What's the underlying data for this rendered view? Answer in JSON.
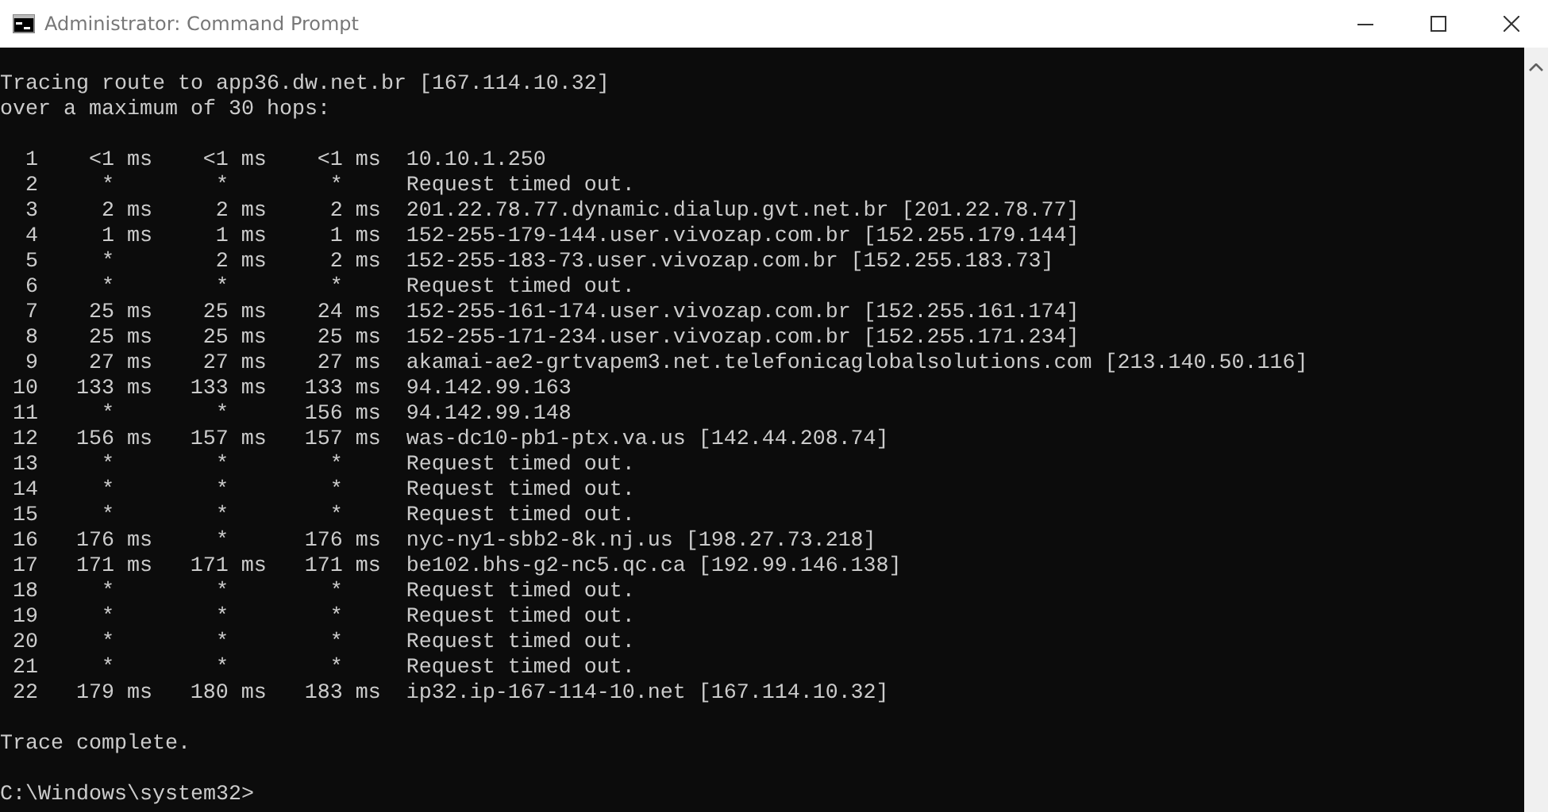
{
  "window": {
    "title": "Administrator: Command Prompt"
  },
  "header": [
    "Tracing route to app36.dw.net.br [167.114.10.32]",
    "over a maximum of 30 hops:"
  ],
  "hops": [
    {
      "hop": "1",
      "times": [
        {
          "text": "<1 ms",
          "timed_out": false
        },
        {
          "text": "<1 ms",
          "timed_out": false
        },
        {
          "text": "<1 ms",
          "timed_out": false
        }
      ],
      "host": "10.10.1.250"
    },
    {
      "hop": "2",
      "times": [
        {
          "text": "*",
          "timed_out": true
        },
        {
          "text": "*",
          "timed_out": true
        },
        {
          "text": "*",
          "timed_out": true
        }
      ],
      "host": "Request timed out."
    },
    {
      "hop": "3",
      "times": [
        {
          "text": "2 ms",
          "timed_out": false
        },
        {
          "text": "2 ms",
          "timed_out": false
        },
        {
          "text": "2 ms",
          "timed_out": false
        }
      ],
      "host": "201.22.78.77.dynamic.dialup.gvt.net.br [201.22.78.77]"
    },
    {
      "hop": "4",
      "times": [
        {
          "text": "1 ms",
          "timed_out": false
        },
        {
          "text": "1 ms",
          "timed_out": false
        },
        {
          "text": "1 ms",
          "timed_out": false
        }
      ],
      "host": "152-255-179-144.user.vivozap.com.br [152.255.179.144]"
    },
    {
      "hop": "5",
      "times": [
        {
          "text": "*",
          "timed_out": true
        },
        {
          "text": "2 ms",
          "timed_out": false
        },
        {
          "text": "2 ms",
          "timed_out": false
        }
      ],
      "host": "152-255-183-73.user.vivozap.com.br [152.255.183.73]"
    },
    {
      "hop": "6",
      "times": [
        {
          "text": "*",
          "timed_out": true
        },
        {
          "text": "*",
          "timed_out": true
        },
        {
          "text": "*",
          "timed_out": true
        }
      ],
      "host": "Request timed out."
    },
    {
      "hop": "7",
      "times": [
        {
          "text": "25 ms",
          "timed_out": false
        },
        {
          "text": "25 ms",
          "timed_out": false
        },
        {
          "text": "24 ms",
          "timed_out": false
        }
      ],
      "host": "152-255-161-174.user.vivozap.com.br [152.255.161.174]"
    },
    {
      "hop": "8",
      "times": [
        {
          "text": "25 ms",
          "timed_out": false
        },
        {
          "text": "25 ms",
          "timed_out": false
        },
        {
          "text": "25 ms",
          "timed_out": false
        }
      ],
      "host": "152-255-171-234.user.vivozap.com.br [152.255.171.234]"
    },
    {
      "hop": "9",
      "times": [
        {
          "text": "27 ms",
          "timed_out": false
        },
        {
          "text": "27 ms",
          "timed_out": false
        },
        {
          "text": "27 ms",
          "timed_out": false
        }
      ],
      "host": "akamai-ae2-grtvapem3.net.telefonicaglobalsolutions.com [213.140.50.116]"
    },
    {
      "hop": "10",
      "times": [
        {
          "text": "133 ms",
          "timed_out": false
        },
        {
          "text": "133 ms",
          "timed_out": false
        },
        {
          "text": "133 ms",
          "timed_out": false
        }
      ],
      "host": "94.142.99.163"
    },
    {
      "hop": "11",
      "times": [
        {
          "text": "*",
          "timed_out": true
        },
        {
          "text": "*",
          "timed_out": true
        },
        {
          "text": "156 ms",
          "timed_out": false
        }
      ],
      "host": "94.142.99.148"
    },
    {
      "hop": "12",
      "times": [
        {
          "text": "156 ms",
          "timed_out": false
        },
        {
          "text": "157 ms",
          "timed_out": false
        },
        {
          "text": "157 ms",
          "timed_out": false
        }
      ],
      "host": "was-dc10-pb1-ptx.va.us [142.44.208.74]"
    },
    {
      "hop": "13",
      "times": [
        {
          "text": "*",
          "timed_out": true
        },
        {
          "text": "*",
          "timed_out": true
        },
        {
          "text": "*",
          "timed_out": true
        }
      ],
      "host": "Request timed out."
    },
    {
      "hop": "14",
      "times": [
        {
          "text": "*",
          "timed_out": true
        },
        {
          "text": "*",
          "timed_out": true
        },
        {
          "text": "*",
          "timed_out": true
        }
      ],
      "host": "Request timed out."
    },
    {
      "hop": "15",
      "times": [
        {
          "text": "*",
          "timed_out": true
        },
        {
          "text": "*",
          "timed_out": true
        },
        {
          "text": "*",
          "timed_out": true
        }
      ],
      "host": "Request timed out."
    },
    {
      "hop": "16",
      "times": [
        {
          "text": "176 ms",
          "timed_out": false
        },
        {
          "text": "*",
          "timed_out": true
        },
        {
          "text": "176 ms",
          "timed_out": false
        }
      ],
      "host": "nyc-ny1-sbb2-8k.nj.us [198.27.73.218]"
    },
    {
      "hop": "17",
      "times": [
        {
          "text": "171 ms",
          "timed_out": false
        },
        {
          "text": "171 ms",
          "timed_out": false
        },
        {
          "text": "171 ms",
          "timed_out": false
        }
      ],
      "host": "be102.bhs-g2-nc5.qc.ca [192.99.146.138]"
    },
    {
      "hop": "18",
      "times": [
        {
          "text": "*",
          "timed_out": true
        },
        {
          "text": "*",
          "timed_out": true
        },
        {
          "text": "*",
          "timed_out": true
        }
      ],
      "host": "Request timed out."
    },
    {
      "hop": "19",
      "times": [
        {
          "text": "*",
          "timed_out": true
        },
        {
          "text": "*",
          "timed_out": true
        },
        {
          "text": "*",
          "timed_out": true
        }
      ],
      "host": "Request timed out."
    },
    {
      "hop": "20",
      "times": [
        {
          "text": "*",
          "timed_out": true
        },
        {
          "text": "*",
          "timed_out": true
        },
        {
          "text": "*",
          "timed_out": true
        }
      ],
      "host": "Request timed out."
    },
    {
      "hop": "21",
      "times": [
        {
          "text": "*",
          "timed_out": true
        },
        {
          "text": "*",
          "timed_out": true
        },
        {
          "text": "*",
          "timed_out": true
        }
      ],
      "host": "Request timed out."
    },
    {
      "hop": "22",
      "times": [
        {
          "text": "179 ms",
          "timed_out": false
        },
        {
          "text": "180 ms",
          "timed_out": false
        },
        {
          "text": "183 ms",
          "timed_out": false
        }
      ],
      "host": "ip32.ip-167-114-10.net [167.114.10.32]"
    }
  ],
  "footer": "Trace complete.",
  "prompt": "C:\\Windows\\system32>"
}
